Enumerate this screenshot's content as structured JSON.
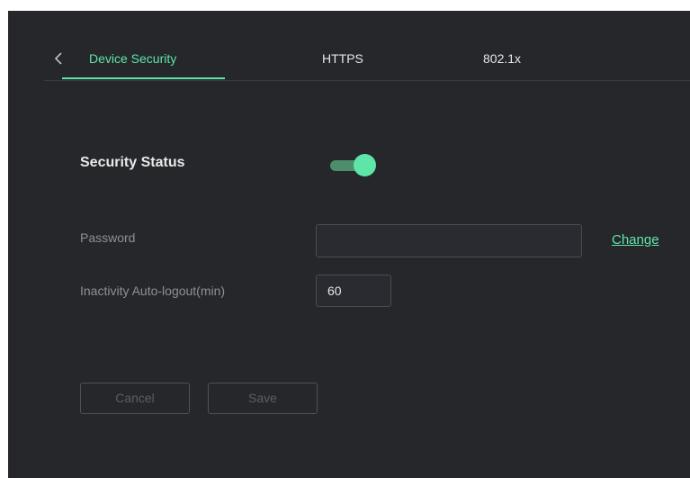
{
  "tabs": [
    {
      "label": "Device Security",
      "active": true
    },
    {
      "label": "HTTPS",
      "active": false
    },
    {
      "label": "802.1x",
      "active": false
    }
  ],
  "back_icon": "chevron-left-icon",
  "security": {
    "title": "Security Status",
    "enabled": true
  },
  "form": {
    "password_label": "Password",
    "password_value": "",
    "change_link": "Change",
    "autologout_label": "Inactivity Auto-logout(min)",
    "autologout_value": "60"
  },
  "buttons": {
    "cancel": "Cancel",
    "save": "Save"
  },
  "colors": {
    "background": "#26272b",
    "accent": "#5ee6a8",
    "toggle_track": "#4d8d6c",
    "muted_text": "#8e9096",
    "disabled_text": "#5c5e63"
  }
}
